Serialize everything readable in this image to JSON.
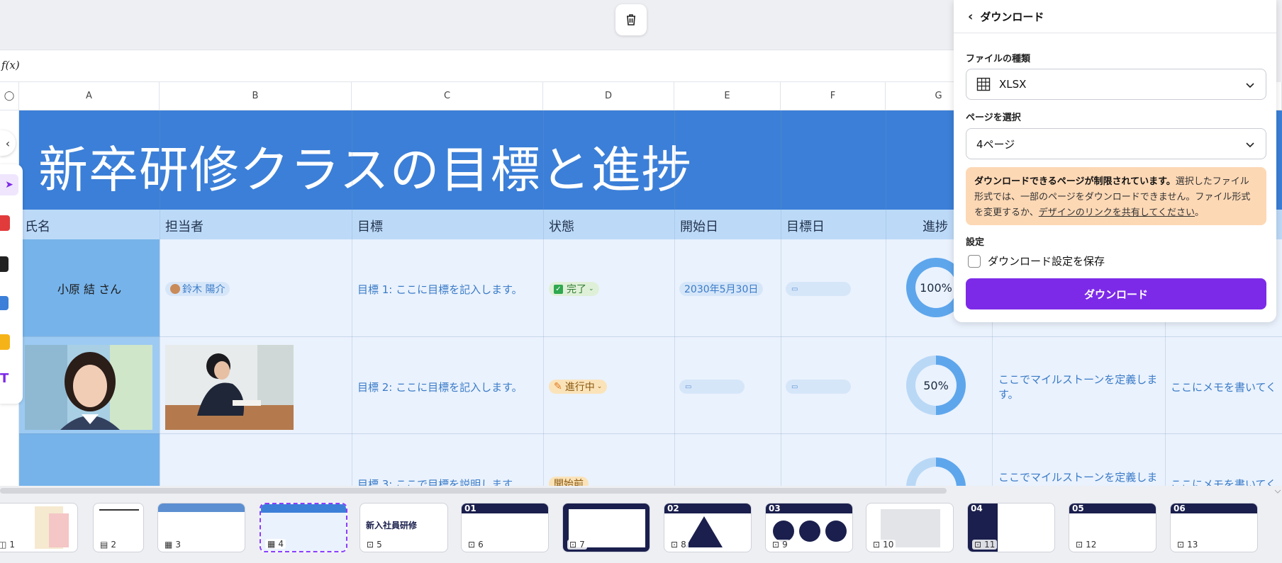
{
  "formula": {
    "label": "f(x)"
  },
  "columns": [
    "A",
    "B",
    "C",
    "D",
    "E",
    "F",
    "G"
  ],
  "sheet": {
    "title": "新卒研修クラスの目標と進捗",
    "headers": [
      "氏名",
      "担当者",
      "目標",
      "状態",
      "開始日",
      "目標日",
      "進捗"
    ],
    "rows": [
      {
        "name": "小原 結 さん",
        "owner": "鈴木 陽介",
        "goal": "目標 1: ここに目標を記入します。",
        "status": "完了",
        "start": "2030年5月30日",
        "progress": 100,
        "progress_label": "100%"
      },
      {
        "goal": "目標 2: ここに目標を記入します。",
        "status": "進行中",
        "progress": 50,
        "progress_label": "50%",
        "milestone": "ここでマイルストーンを定義します。",
        "memo": "ここにメモを書いてく"
      },
      {
        "goal": "目標 3: ここで目標を説明します",
        "status": "開始前",
        "milestone": "ここでマイルストーンを定義しま",
        "memo": "ここにメモを書いてく"
      }
    ]
  },
  "panel": {
    "title": "ダウンロード",
    "file_type_label": "ファイルの種類",
    "file_type_value": "XLSX",
    "page_label": "ページを選択",
    "page_value": "4ページ",
    "warning_bold": "ダウンロードできるページが制限されています。",
    "warning_text1": "選択したファイル形式では、一部のページをダウンロードできません。ファイル形式を変更するか、",
    "warning_link": "デザインのリンクを共有してください",
    "warning_end": "。",
    "settings_label": "設定",
    "save_setting_label": "ダウンロード設定を保存",
    "download_button": "ダウンロード"
  },
  "thumbnails": [
    {
      "num": "1",
      "icon": "doc-whiteboard-icon"
    },
    {
      "num": "2",
      "icon": "doc-icon"
    },
    {
      "num": "3",
      "icon": "sheet-icon"
    },
    {
      "num": "4",
      "icon": "sheet-icon",
      "selected": true
    },
    {
      "num": "5",
      "icon": "presentation-icon",
      "text": "新入社員研修"
    },
    {
      "num": "6",
      "icon": "presentation-icon",
      "text": "01"
    },
    {
      "num": "7",
      "icon": "presentation-icon"
    },
    {
      "num": "8",
      "icon": "presentation-icon",
      "text": "02"
    },
    {
      "num": "9",
      "icon": "presentation-icon",
      "text": "03"
    },
    {
      "num": "10",
      "icon": "presentation-icon"
    },
    {
      "num": "11",
      "icon": "presentation-icon",
      "text": "04"
    },
    {
      "num": "12",
      "icon": "presentation-icon",
      "text": "05"
    },
    {
      "num": "13",
      "icon": "presentation-icon",
      "text": "06"
    }
  ],
  "colors": {
    "accent": "#7d2ae8",
    "banner": "#3b7fd8",
    "header_row": "#bcdaf8",
    "name_col": "#76b3ea"
  }
}
